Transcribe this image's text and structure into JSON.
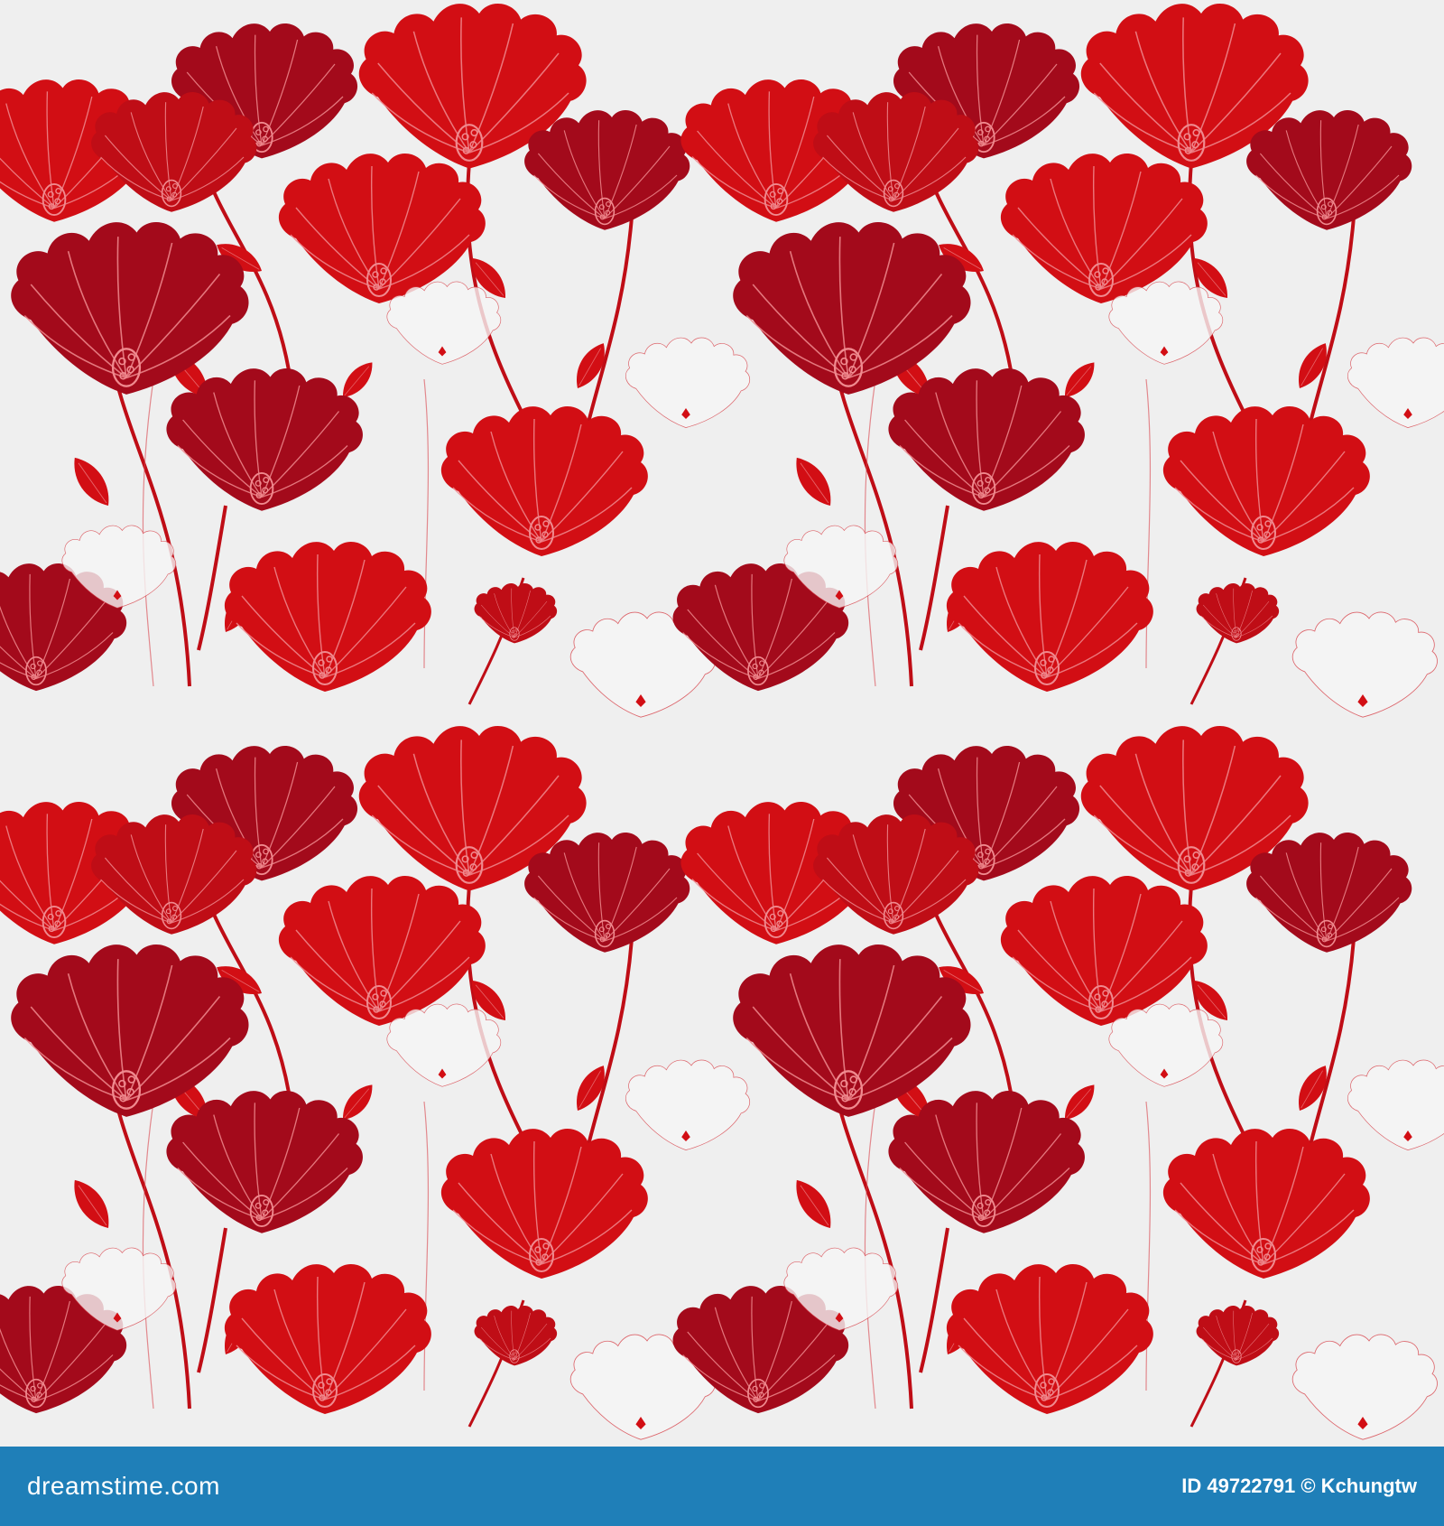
{
  "pattern": {
    "colors": {
      "background": "#efefef",
      "bright_red": "#d20e14",
      "mid_red": "#bf0d16",
      "dark_red": "#a30a1b",
      "vein": "#f08a8f",
      "outline_red": "#d8434b"
    },
    "motifs": [
      "red-mallow-flower",
      "dark-red-mallow-flower",
      "outlined-white-mallow-flower",
      "leaf",
      "stem",
      "bud"
    ]
  },
  "footer": {
    "brand": "dreamstime.com",
    "image_id": "ID 49722791 © Kchungtw",
    "color": "#1f7fb8"
  }
}
